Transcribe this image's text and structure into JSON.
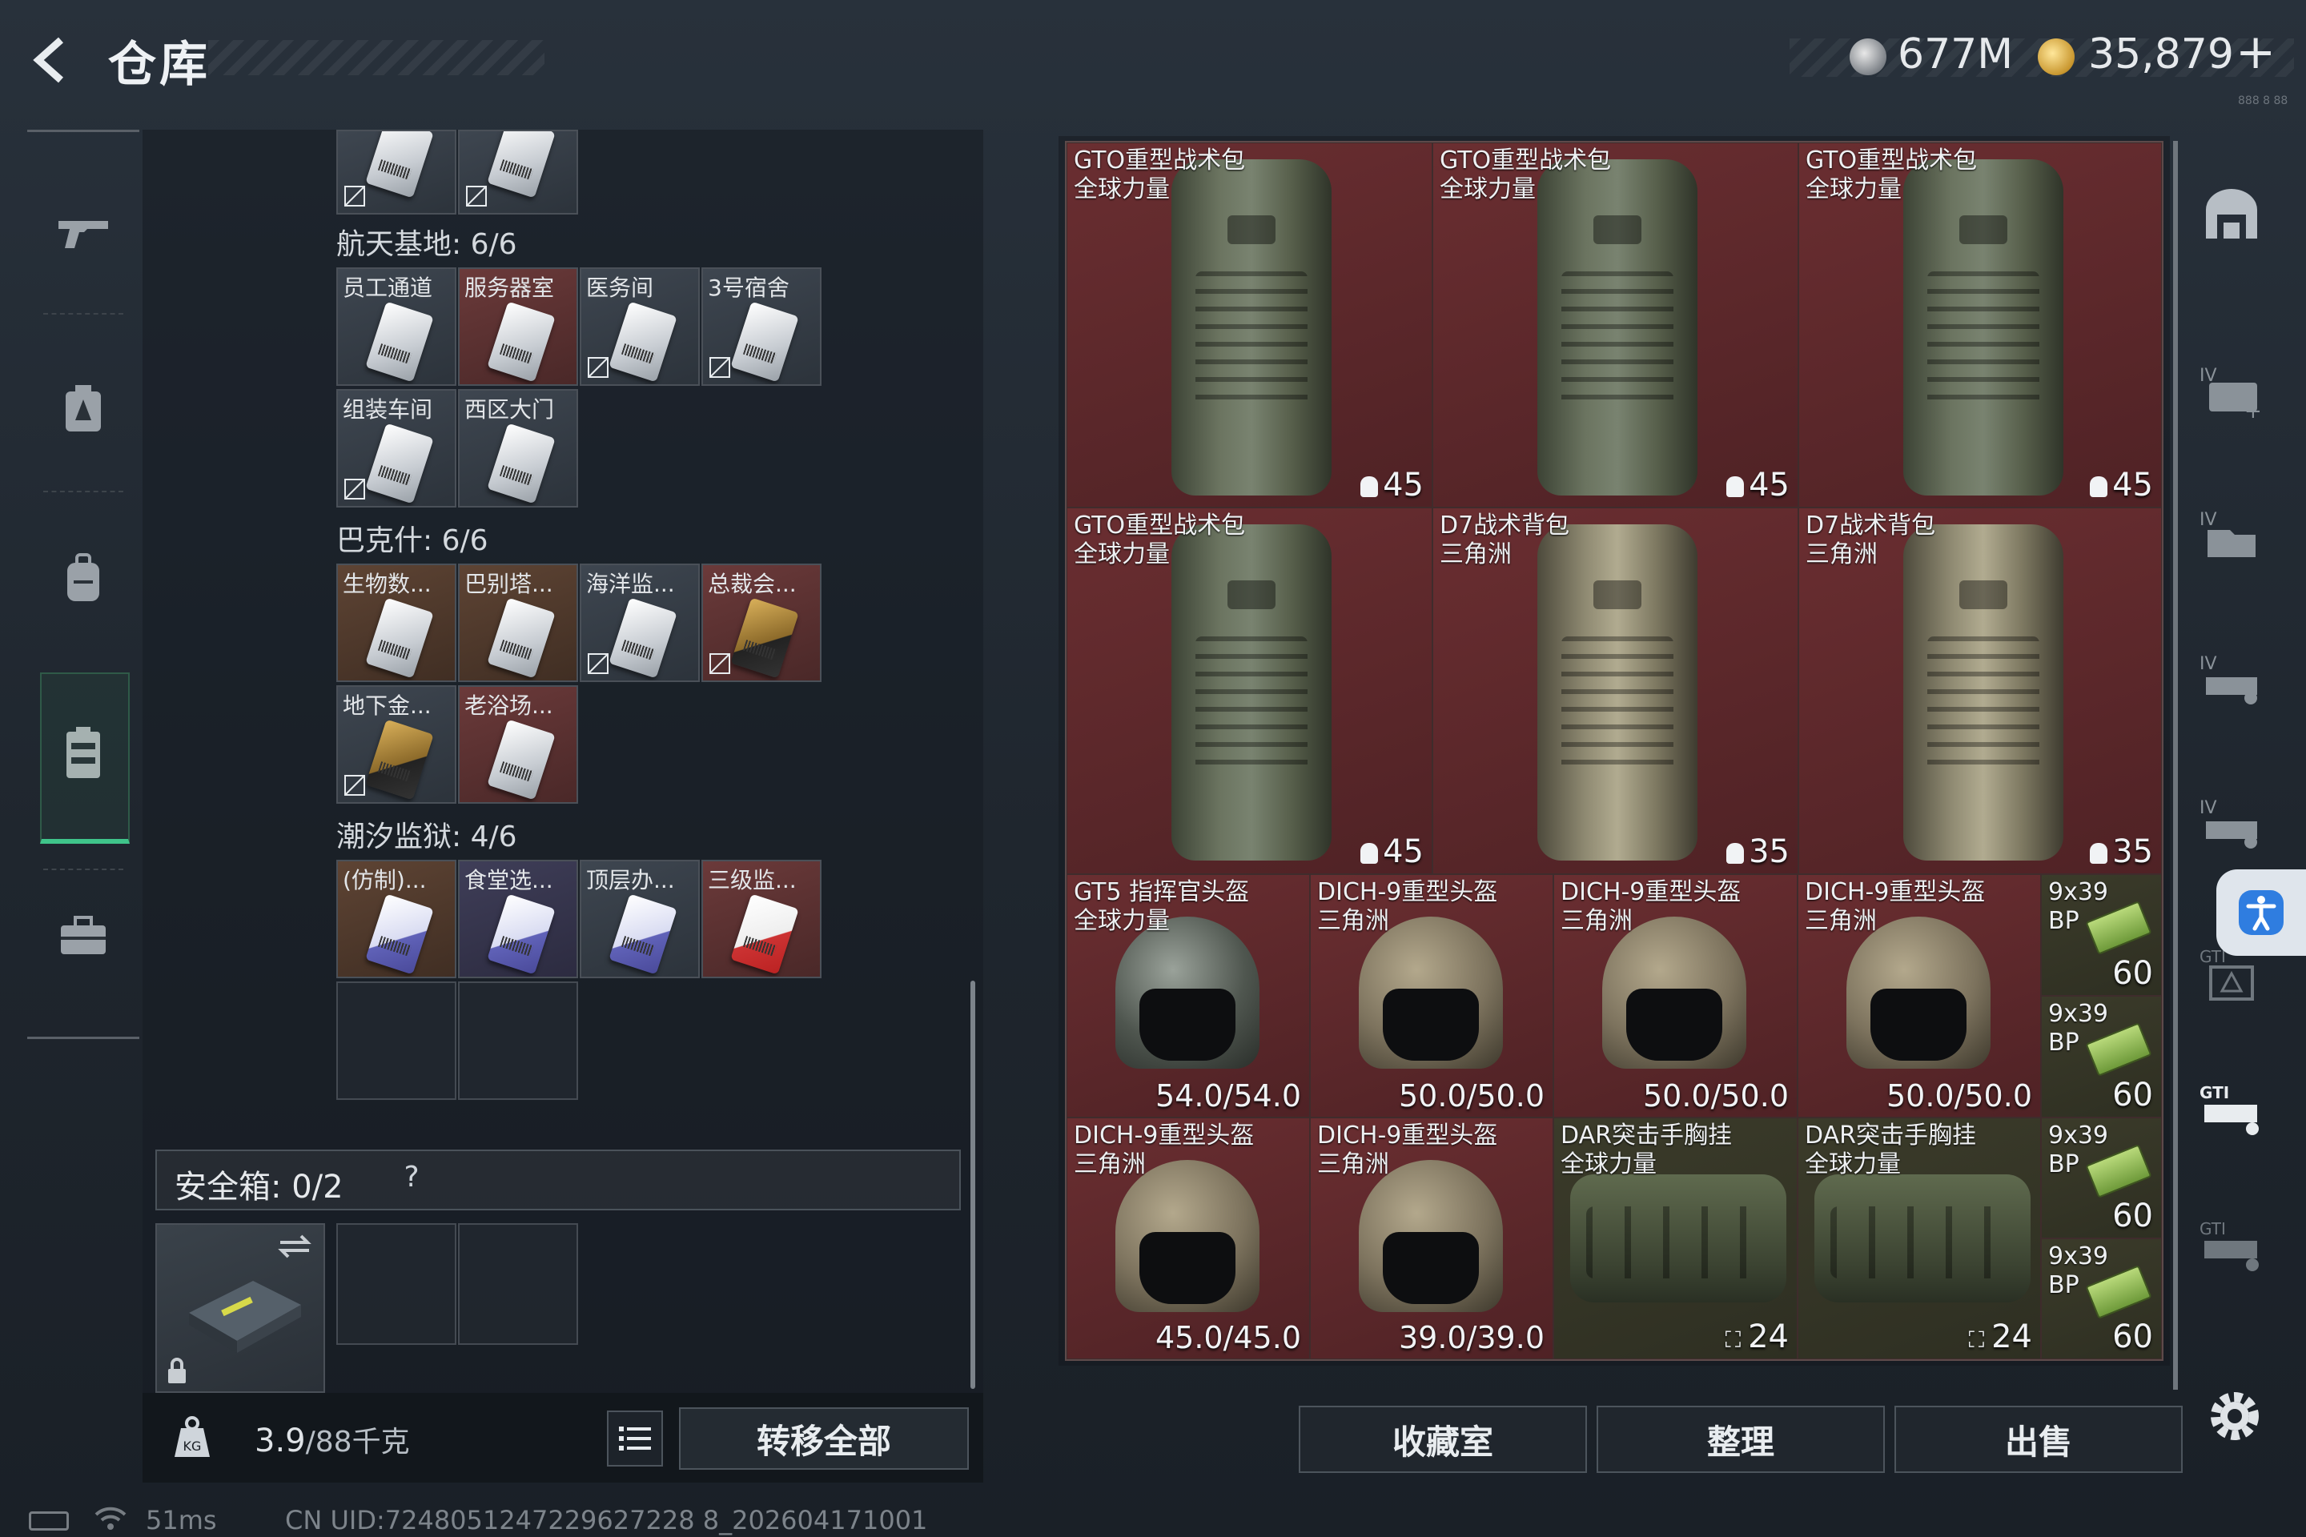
{
  "header": {
    "title": "仓库",
    "currency1": "677M",
    "currency2": "35,879",
    "add_label": "+",
    "tiny_text": "888 8 88"
  },
  "left_nav": {
    "items": [
      "weapon-icon",
      "armor-icon",
      "backpack-icon",
      "keycard-icon",
      "case-icon"
    ],
    "active": "keycard-icon"
  },
  "sections": [
    {
      "label": "航天基地: 6/6",
      "slots": [
        {
          "name": "员工通道",
          "color": "gray"
        },
        {
          "name": "服务器室",
          "color": "red"
        },
        {
          "name": "医务间",
          "color": "gray"
        },
        {
          "name": "3号宿舍",
          "color": "gray"
        },
        {
          "name": "组装车间",
          "color": "gray"
        },
        {
          "name": "西区大门",
          "color": "gray"
        }
      ]
    },
    {
      "label": "巴克什: 6/6",
      "slots": [
        {
          "name": "生物数...",
          "color": "brown"
        },
        {
          "name": "巴别塔...",
          "color": "brown"
        },
        {
          "name": "海洋监...",
          "color": "gray"
        },
        {
          "name": "总裁会...",
          "color": "red"
        },
        {
          "name": "地下金...",
          "color": "gray"
        },
        {
          "name": "老浴场...",
          "color": "red"
        }
      ]
    },
    {
      "label": "潮汐监狱: 4/6",
      "slots": [
        {
          "name": "(仿制)...",
          "color": "brown"
        },
        {
          "name": "食堂选...",
          "color": "purple"
        },
        {
          "name": "顶层办...",
          "color": "gray"
        },
        {
          "name": "三级监...",
          "color": "red"
        }
      ]
    }
  ],
  "safebox": {
    "label": "安全箱: 0/2",
    "help": "?"
  },
  "weight": {
    "current": "3.9",
    "limit": "/88千克",
    "icon": "KG"
  },
  "buttons": {
    "transfer_all": "转移全部",
    "collection": "收藏室",
    "arrange": "整理",
    "sell": "出售"
  },
  "grid_items": [
    {
      "name": "GTO重型战术包\n全球力量",
      "value": "45",
      "type": "backpack"
    },
    {
      "name": "GTO重型战术包\n全球力量",
      "value": "45",
      "type": "backpack"
    },
    {
      "name": "GTO重型战术包\n全球力量",
      "value": "45",
      "type": "backpack"
    },
    {
      "name": "GTO重型战术包\n全球力量",
      "value": "45",
      "type": "backpack"
    },
    {
      "name": "D7战术背包\n三角洲",
      "value": "35",
      "type": "backpack-tan"
    },
    {
      "name": "D7战术背包\n三角洲",
      "value": "35",
      "type": "backpack-tan"
    },
    {
      "name": "GT5 指挥官头盔\n全球力量",
      "value": "54.0/54.0",
      "type": "helmet-gt5"
    },
    {
      "name": "DICH-9重型头盔\n三角洲",
      "value": "50.0/50.0",
      "type": "helmet"
    },
    {
      "name": "DICH-9重型头盔\n三角洲",
      "value": "50.0/50.0",
      "type": "helmet"
    },
    {
      "name": "DICH-9重型头盔\n三角洲",
      "value": "50.0/50.0",
      "type": "helmet"
    },
    {
      "name": "DICH-9重型头盔\n三角洲",
      "value": "45.0/45.0",
      "type": "helmet"
    },
    {
      "name": "DICH-9重型头盔\n三角洲",
      "value": "39.0/39.0",
      "type": "helmet"
    },
    {
      "name": "DAR突击手胸挂\n全球力量",
      "value": "24",
      "type": "vest"
    },
    {
      "name": "DAR突击手胸挂\n全球力量",
      "value": "24",
      "type": "vest"
    },
    {
      "name": "9x39\nBP",
      "value": "60",
      "type": "ammo"
    },
    {
      "name": "9x39\nBP",
      "value": "60",
      "type": "ammo"
    },
    {
      "name": "9x39\nBP",
      "value": "60",
      "type": "ammo"
    },
    {
      "name": "9x39\nBP",
      "value": "60",
      "type": "ammo"
    }
  ],
  "right_nav": {
    "items": [
      "warehouse-icon",
      "IV",
      "IV",
      "IV",
      "IV",
      "GTI",
      "GTI",
      "GTI"
    ]
  },
  "status": {
    "ping": "51ms",
    "uid": "CN UID:7248051247229627228 8_202604171001"
  }
}
